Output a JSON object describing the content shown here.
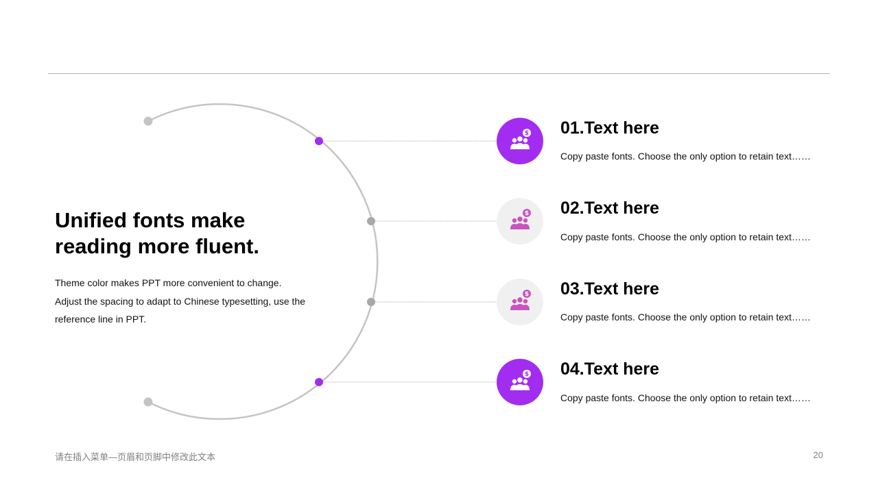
{
  "headline": {
    "line1": "Unified fonts make",
    "line2": "reading more fluent."
  },
  "body": {
    "lines": [
      "Theme color makes PPT more convenient to change.",
      "Adjust the spacing to adapt to Chinese typesetting, use the",
      "reference line in PPT."
    ]
  },
  "items": [
    {
      "title": "01.Text here",
      "desc": "Copy paste fonts. Choose the only option to retain text……",
      "state": "active",
      "icon": "people-money-icon"
    },
    {
      "title": "02.Text here",
      "desc": "Copy paste fonts. Choose the only option to retain text……",
      "state": "inactive",
      "icon": "people-money-icon"
    },
    {
      "title": "03.Text here",
      "desc": "Copy paste fonts. Choose the only option to retain text……",
      "state": "inactive",
      "icon": "people-money-icon"
    },
    {
      "title": "04.Text here",
      "desc": "Copy paste fonts. Choose the only option to retain text……",
      "state": "active",
      "icon": "people-money-icon"
    }
  ],
  "footer": {
    "text": "请在插入菜单—页眉和页脚中修改此文本",
    "page_number": "20"
  },
  "colors": {
    "accent": "#a22df0",
    "icon_inactive": "#c854bd",
    "arc": "#c4c4c4",
    "dot_gray": "#a8a8a8"
  }
}
